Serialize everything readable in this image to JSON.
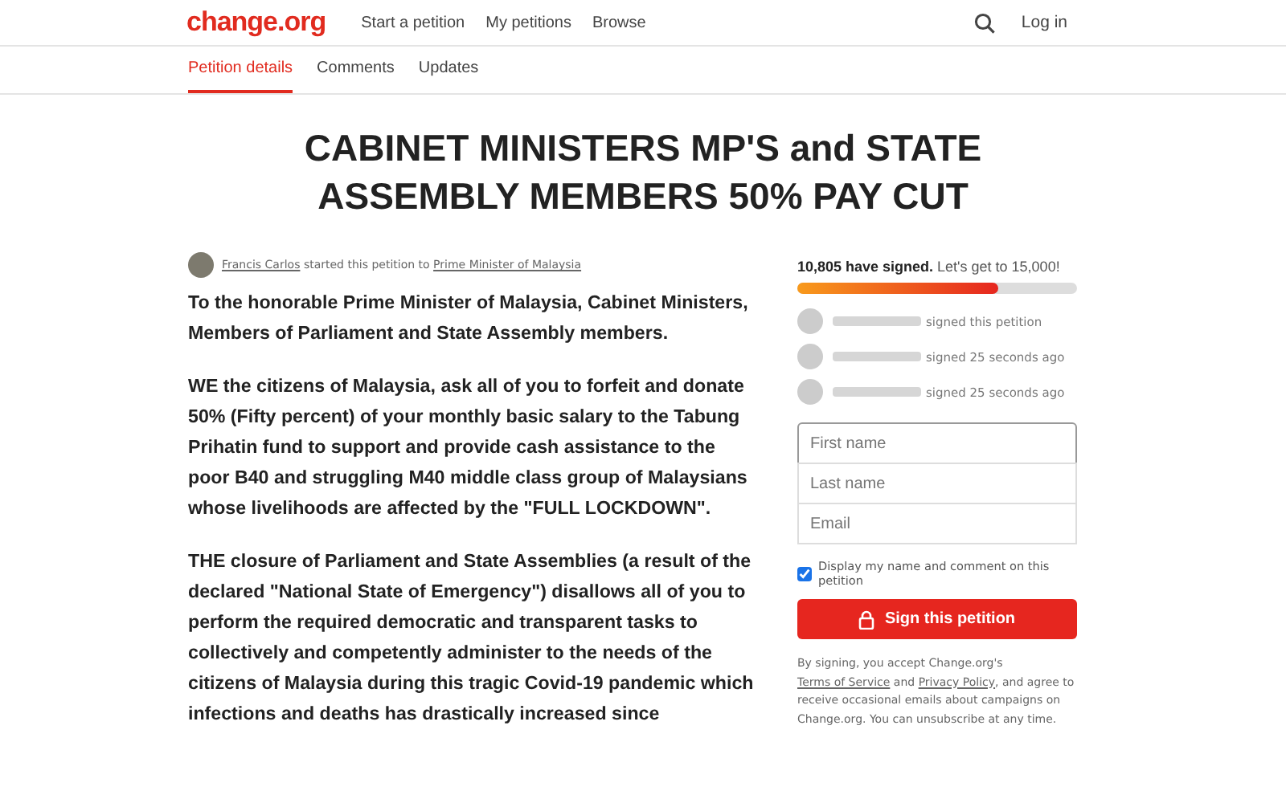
{
  "header": {
    "logo": "change.org",
    "nav": [
      "Start a petition",
      "My petitions",
      "Browse"
    ],
    "login": "Log in"
  },
  "tabs": [
    {
      "label": "Petition details",
      "selected": true
    },
    {
      "label": "Comments",
      "selected": false
    },
    {
      "label": "Updates",
      "selected": false
    }
  ],
  "title": "CABINET MINISTERS MP'S and STATE ASSEMBLY MEMBERS 50% PAY CUT",
  "byline": {
    "author": "Francis Carlos",
    "middle": "started this petition to",
    "target": "Prime Minister of Malaysia"
  },
  "body": [
    "To the honorable Prime Minister of Malaysia, Cabinet Ministers, Members of Parliament and State Assembly members.",
    "WE the citizens of Malaysia, ask all of you to forfeit and donate 50% (Fifty percent) of your monthly basic salary to the Tabung Prihatin fund to support and provide cash assistance to the poor B40 and struggling M40 middle class group of Malaysians whose livelihoods are affected by the \"FULL LOCKDOWN\".",
    "THE closure of Parliament and State Assemblies (a result of the declared \"National State of Emergency\") disallows all of you to perform the required democratic and transparent tasks to collectively and competently administer to the needs of the citizens of Malaysia during this tragic Covid-19 pandemic which infections and deaths has drastically increased since"
  ],
  "progress": {
    "count": "10,805 have signed.",
    "goal": "Let's get to 15,000!",
    "level": 0.72
  },
  "signers": [
    {
      "text": "signed this petition"
    },
    {
      "text": "signed 25 seconds ago"
    },
    {
      "text": "signed 25 seconds ago"
    }
  ],
  "form": {
    "fields": [
      {
        "placeholder": "First name"
      },
      {
        "placeholder": "Last name"
      },
      {
        "placeholder": "Email"
      }
    ],
    "display": {
      "label": "Display my name and comment on this petition",
      "checked": true
    },
    "submit": "Sign this petition",
    "legal": {
      "pre": "By signing, you accept Change.org's",
      "terms": "Terms of Service",
      "and": "and",
      "privacy": "Privacy Policy",
      "post": ", and agree to receive occasional emails about campaigns on Change.org. You can unsubscribe at any time."
    }
  }
}
